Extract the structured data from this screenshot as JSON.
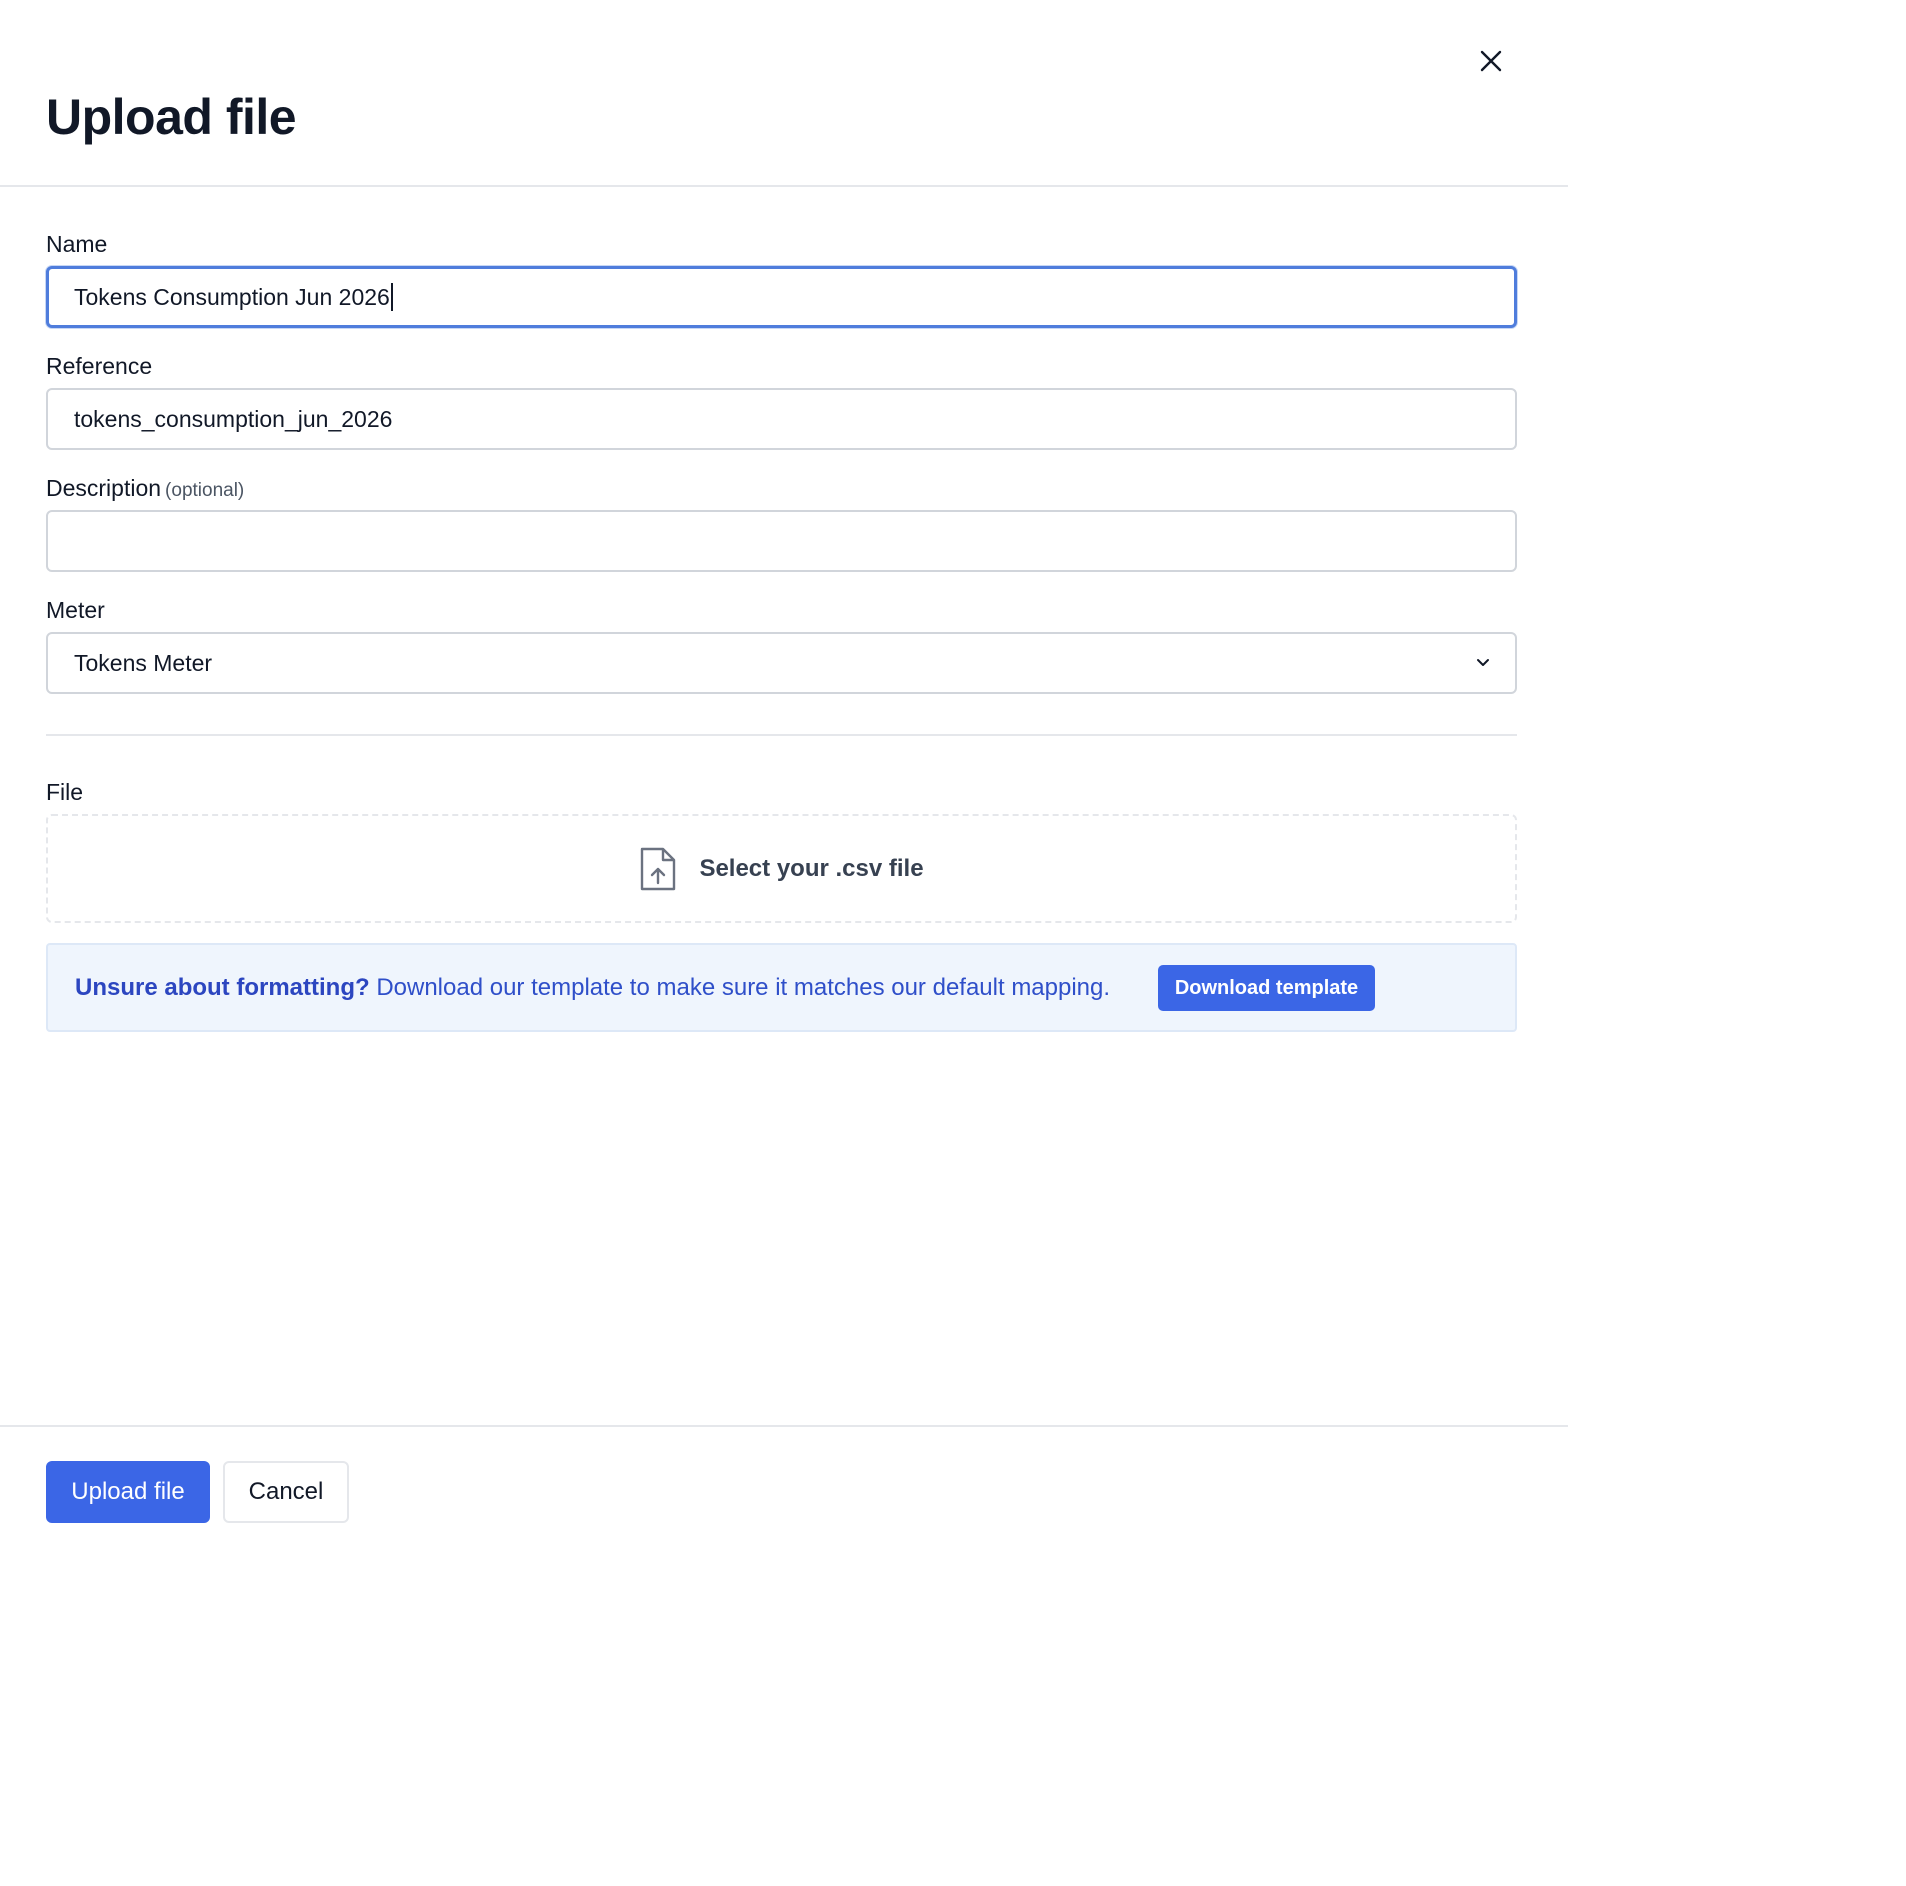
{
  "dialog": {
    "title": "Upload file",
    "close_icon": "close-icon"
  },
  "form": {
    "name": {
      "label": "Name",
      "value": "Tokens Consumption Jun 2026"
    },
    "reference": {
      "label": "Reference",
      "value": "tokens_consumption_jun_2026"
    },
    "description": {
      "label": "Description",
      "optional_label": "(optional)",
      "value": ""
    },
    "meter": {
      "label": "Meter",
      "selected": "Tokens Meter",
      "icon": "chevron-down-icon"
    }
  },
  "file": {
    "label": "File",
    "dropzone_text": "Select your .csv file",
    "icon": "file-upload-icon"
  },
  "notice": {
    "strong": "Unsure about formatting?",
    "text": " Download our template to make sure it matches our default mapping.",
    "button_label": "Download template"
  },
  "footer": {
    "primary_label": "Upload file",
    "secondary_label": "Cancel"
  },
  "colors": {
    "accent": "#3b66e6",
    "focus_border": "#4f7ddc",
    "notice_bg": "#eff5fd",
    "notice_text": "#2f4fc9"
  }
}
